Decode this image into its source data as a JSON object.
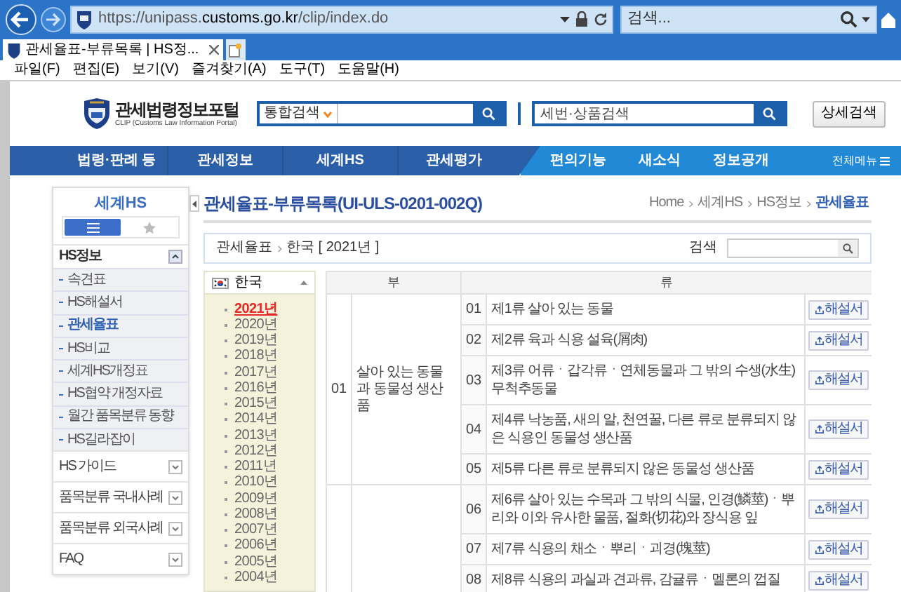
{
  "browser": {
    "url_prefix": "https://unipass.",
    "url_domain": "customs.go.kr",
    "url_path": "/clip/index.do",
    "search_placeholder": "검색...",
    "tab_title": "관세율표-부류목록 | HS정...",
    "menu": [
      "파일(F)",
      "편집(E)",
      "보기(V)",
      "즐겨찾기(A)",
      "도구(T)",
      "도움말(H)"
    ]
  },
  "header": {
    "logo_title": "관세법령정보포털",
    "logo_subtitle": "CLIP (Customs Law Information Portal)",
    "search_scope": "통합검색",
    "code_search_placeholder": "세번·상품검색",
    "detail_button": "상세검색"
  },
  "nav": {
    "primary": [
      "법령·판례 등",
      "관세정보",
      "세계HS",
      "관세평가"
    ],
    "secondary": [
      "편의기능",
      "새소식",
      "정보공개"
    ],
    "all_menu": "전체메뉴"
  },
  "sidebar": {
    "title": "세계HS",
    "view_toggle": [
      {
        "kind": "list",
        "selected": true
      },
      {
        "kind": "star",
        "selected": false
      }
    ],
    "sections": [
      {
        "label": "HS정보",
        "expanded": true,
        "children": [
          {
            "label": "속견표",
            "selected": false
          },
          {
            "label": "HS해설서",
            "selected": false
          },
          {
            "label": "관세율표",
            "selected": true
          },
          {
            "label": "HS비교",
            "selected": false
          },
          {
            "label": "세계HS개정표",
            "selected": false
          },
          {
            "label": "HS협약 개정자료",
            "selected": false
          },
          {
            "label": "월간 품목분류 동향",
            "selected": false
          },
          {
            "label": "HS길라잡이",
            "selected": false
          }
        ]
      },
      {
        "label": "HS 가이드",
        "expanded": false
      },
      {
        "label": "품목분류 국내사례",
        "expanded": false
      },
      {
        "label": "품목분류 외국사례",
        "expanded": false
      },
      {
        "label": "FAQ",
        "expanded": false
      }
    ]
  },
  "page": {
    "title": "관세율표-부류목록(UI-ULS-0201-002Q)",
    "breadcrumb": [
      "Home",
      "세계HS",
      "HS정보",
      "관세율표"
    ],
    "path": [
      "관세율표",
      "한국 [ 2021년 ]"
    ],
    "search_label": "검색"
  },
  "country": {
    "name": "한국",
    "expanded": true
  },
  "years": [
    {
      "label": "2021년",
      "selected": true
    },
    {
      "label": "2020년",
      "selected": false
    },
    {
      "label": "2019년",
      "selected": false
    },
    {
      "label": "2018년",
      "selected": false
    },
    {
      "label": "2017년",
      "selected": false
    },
    {
      "label": "2016년",
      "selected": false
    },
    {
      "label": "2015년",
      "selected": false
    },
    {
      "label": "2014년",
      "selected": false
    },
    {
      "label": "2013년",
      "selected": false
    },
    {
      "label": "2012년",
      "selected": false
    },
    {
      "label": "2011년",
      "selected": false
    },
    {
      "label": "2010년",
      "selected": false
    },
    {
      "label": "2009년",
      "selected": false
    },
    {
      "label": "2008년",
      "selected": false
    },
    {
      "label": "2007년",
      "selected": false
    },
    {
      "label": "2006년",
      "selected": false
    },
    {
      "label": "2005년",
      "selected": false
    },
    {
      "label": "2004년",
      "selected": false
    }
  ],
  "table": {
    "columns": [
      "부",
      "류"
    ],
    "sections": [
      {
        "number": "01",
        "name": "살아 있는 동물과 동물성 생산품",
        "chapters": [
          {
            "number": "01",
            "title": "제1류 살아 있는 동물",
            "button": "해설서"
          },
          {
            "number": "02",
            "title": "제2류 육과 식용 설육(屑肉)",
            "button": "해설서"
          },
          {
            "number": "03",
            "title": "제3류 어류ㆍ갑각류ㆍ연체동물과 그 밖의 수생(水生) 무척추동물",
            "button": "해설서"
          },
          {
            "number": "04",
            "title": "제4류 낙농품, 새의 알, 천연꿀, 다른 류로 분류되지 않은 식용인 동물성 생산품",
            "button": "해설서"
          },
          {
            "number": "05",
            "title": "제5류 다른 류로 분류되지 않은 동물성 생산품",
            "button": "해설서"
          }
        ]
      },
      {
        "chapters": [
          {
            "number": "06",
            "title": "제6류 살아 있는 수목과 그 밖의 식물, 인경(鱗莖)ㆍ뿌리와 이와 유사한 물품, 절화(切花)와 장식용 잎",
            "button": "해설서"
          },
          {
            "number": "07",
            "title": "제7류 식용의 채소ㆍ뿌리ㆍ괴경(塊莖)",
            "button": "해설서"
          },
          {
            "number": "08",
            "title": "제8류 식용의 과실과 견과류, 감귤류ㆍ멜론의 껍질",
            "button": "해설서"
          }
        ]
      }
    ]
  }
}
